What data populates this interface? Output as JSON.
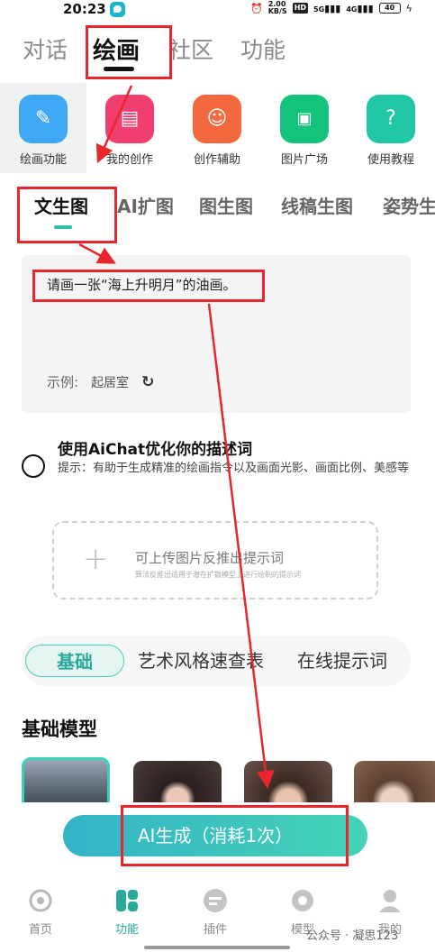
{
  "status_bar": {
    "time": "20:23",
    "speed": "2.00",
    "speed_unit": "KB/S",
    "hd": "HD",
    "signal_1": "5G",
    "signal_2": "4G",
    "battery": "40"
  },
  "top_tabs": [
    {
      "label": "对话"
    },
    {
      "label": "绘画"
    },
    {
      "label": "社区"
    },
    {
      "label": "功能"
    }
  ],
  "features": [
    {
      "label": "绘画功能",
      "icon": "pencil-icon",
      "color": "#3fa8f5"
    },
    {
      "label": "我的创作",
      "icon": "book-icon",
      "color": "#ef3e6f"
    },
    {
      "label": "创作辅助",
      "icon": "users-icon",
      "color": "#f4683f"
    },
    {
      "label": "图片广场",
      "icon": "picture-char-icon",
      "color": "#14c37b"
    },
    {
      "label": "使用教程",
      "icon": "question-icon",
      "color": "#21c7a4"
    }
  ],
  "sub_tabs": [
    {
      "label": "文生图"
    },
    {
      "label": "AI扩图"
    },
    {
      "label": "图生图"
    },
    {
      "label": "线稿生图"
    },
    {
      "label": "姿势生"
    }
  ],
  "prompt": {
    "text": "请画一张“海上升明月”的油画。",
    "example_label": "示例:",
    "example_chip": "起居室"
  },
  "optimize": {
    "title": "使用AiChat优化你的描述词",
    "tip": "提示：有助于生成精准的绘画指令以及画面光影、画面比例、美感等"
  },
  "upload": {
    "main": "可上传图片反推出提示词",
    "sub": "算法反推出适用于潜在扩散模型上进行绘制的提示词"
  },
  "pill_tabs": [
    {
      "label": "基础"
    },
    {
      "label": "艺术风格速查表"
    },
    {
      "label": "在线提示词"
    }
  ],
  "models": {
    "title": "基础模型"
  },
  "generate_button": "AI生成（消耗1次）",
  "bottom_nav": [
    {
      "label": "首页",
      "icon": "home-icon"
    },
    {
      "label": "功能",
      "icon": "function-icon"
    },
    {
      "label": "插件",
      "icon": "plugin-icon"
    },
    {
      "label": "模型",
      "icon": "model-icon"
    },
    {
      "label": "我的",
      "icon": "profile-icon"
    }
  ],
  "watermark": "公众号 · 凝思123",
  "colors": {
    "accent": "#2aa99a",
    "annotation": "#e8262c"
  }
}
